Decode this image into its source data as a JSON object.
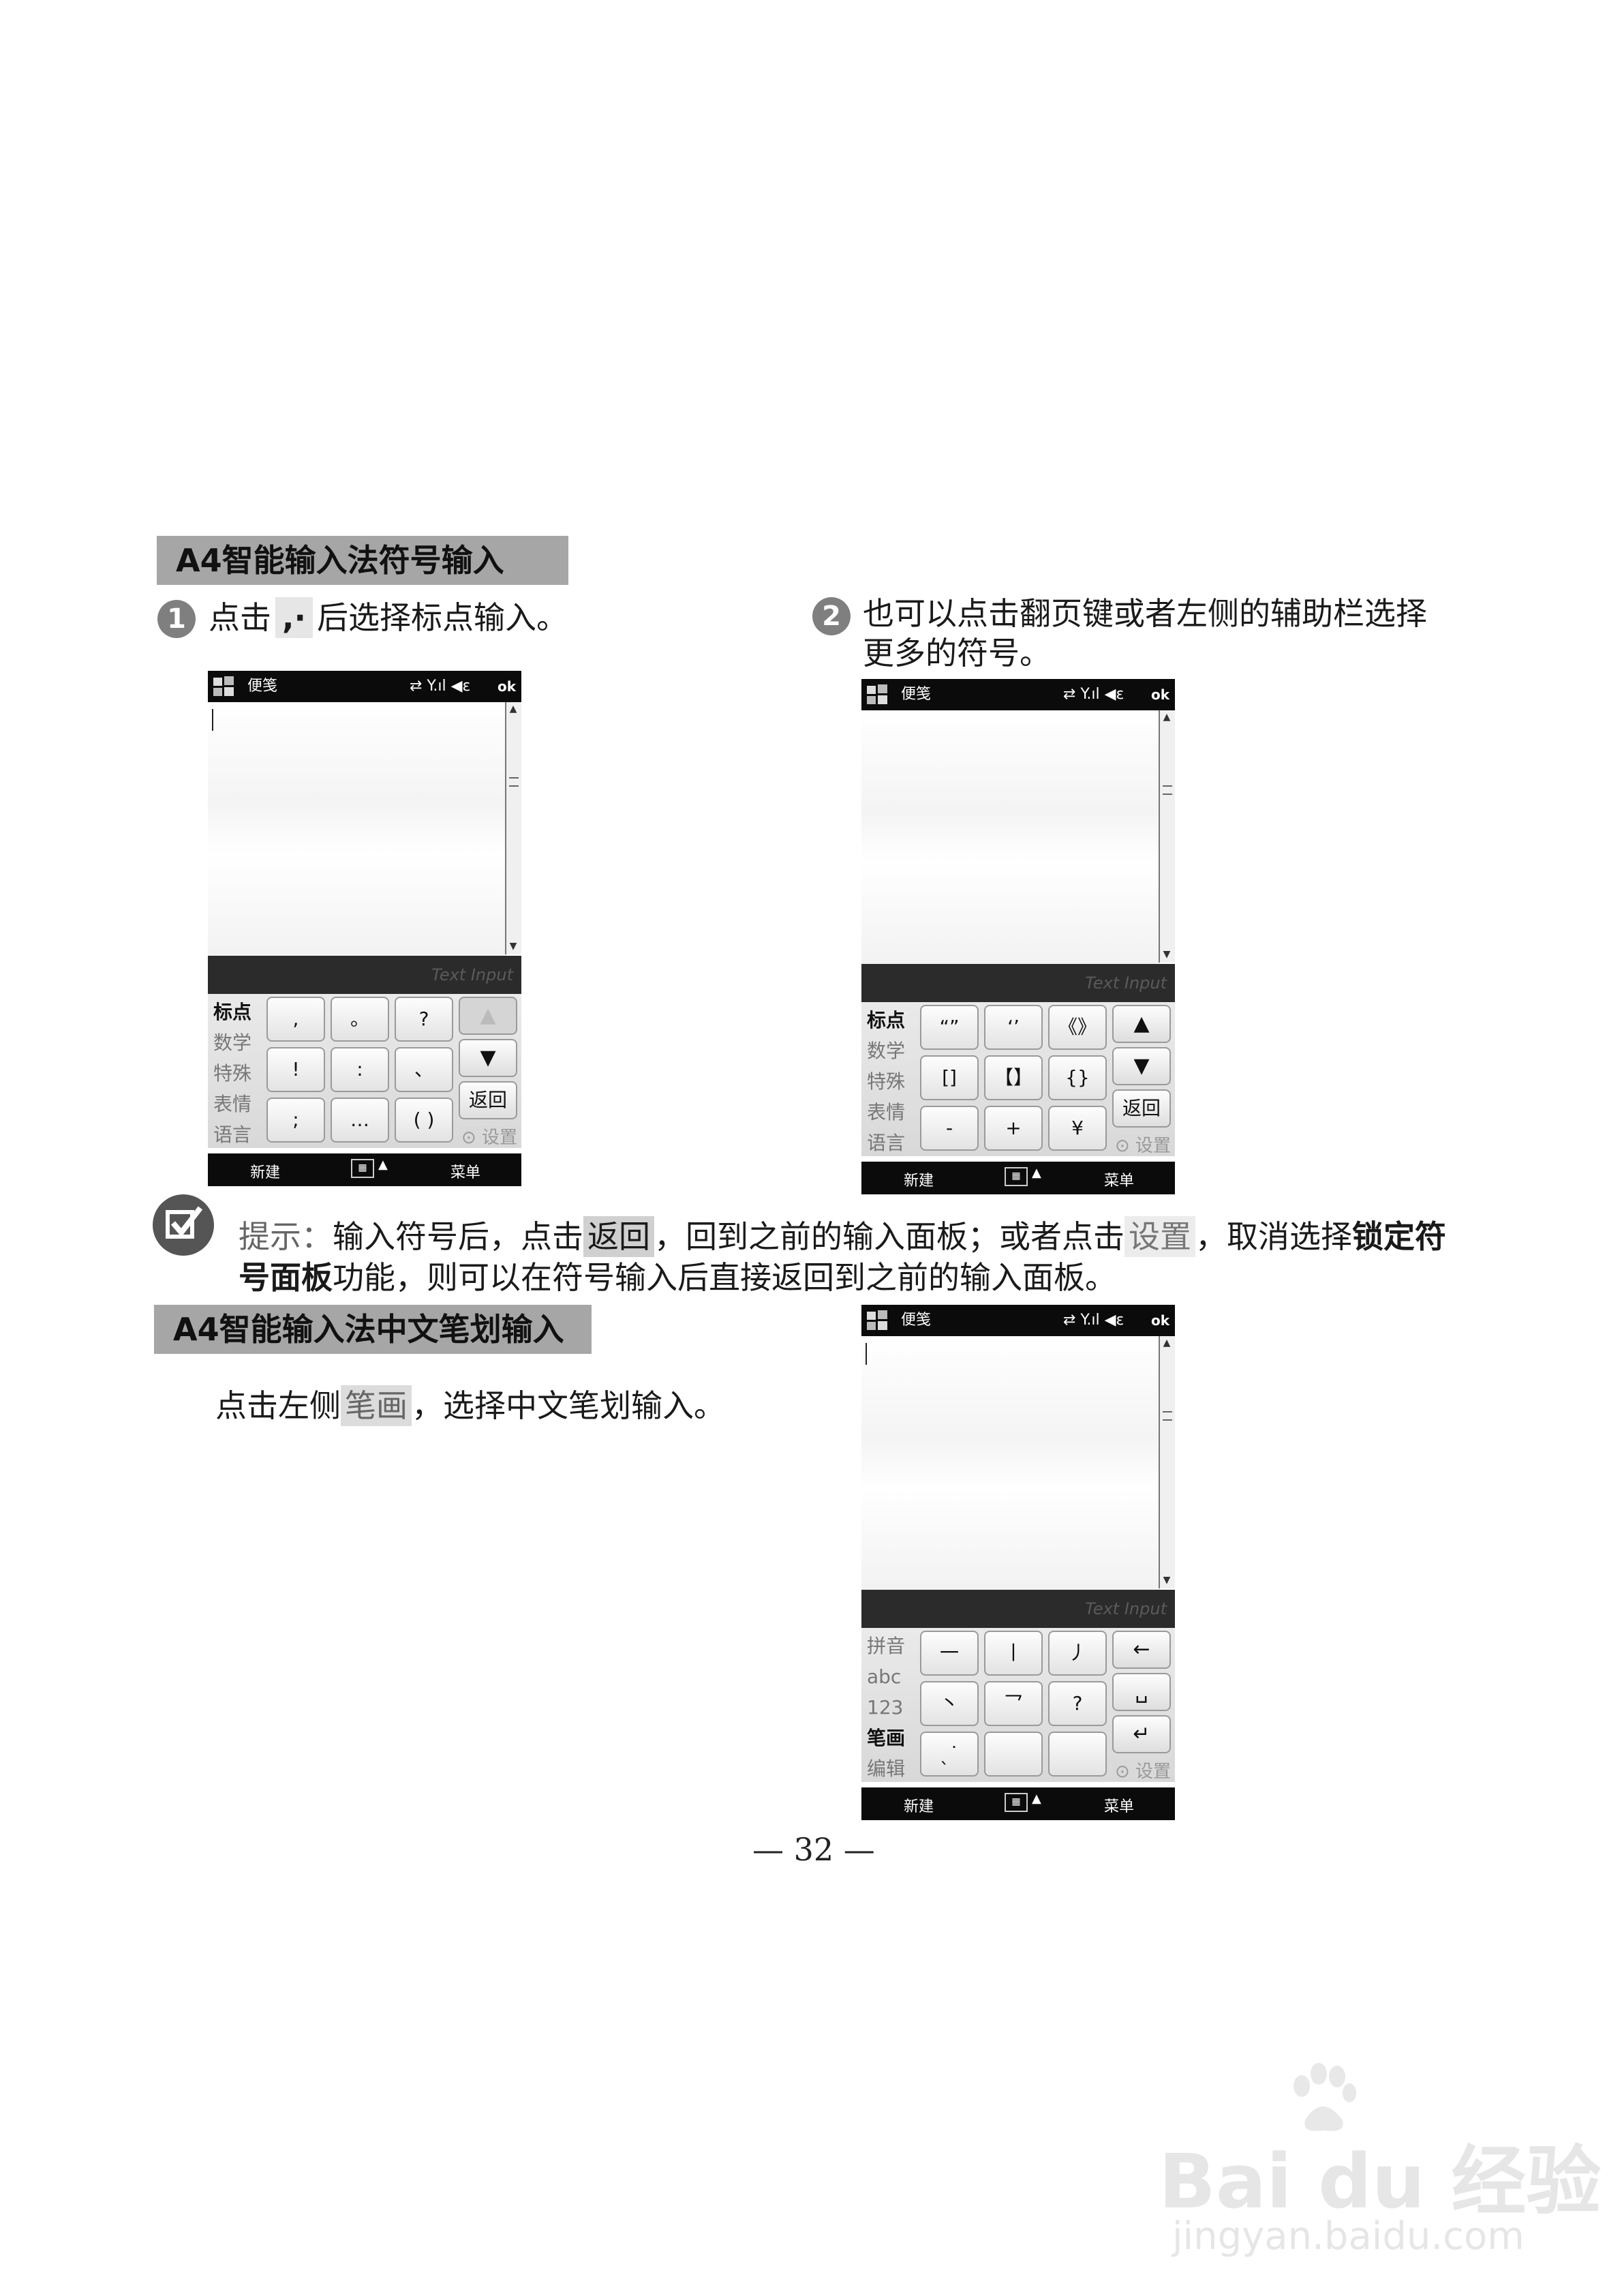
{
  "section1": {
    "title": "A4智能输入法符号输入"
  },
  "step1": {
    "num": "1",
    "before": "点击",
    "key": ",·",
    "after": "后选择标点输入。"
  },
  "step2": {
    "num": "2",
    "line1": "也可以点击翻页键或者左侧的辅助栏选择",
    "line2": "更多的符号。"
  },
  "phone_common": {
    "app_title": "便笺",
    "status_icons": "⇄ Y.ıl ◀ε",
    "ok": "ok",
    "text_input_label": "Text Input",
    "left_soft": "新建",
    "right_soft": "菜单",
    "setting": "⊙ 设置",
    "back": "返回"
  },
  "phone1": {
    "side": [
      "标点",
      "数学",
      "特殊",
      "表情",
      "语言"
    ],
    "keys": [
      ",",
      "。",
      "?",
      "!",
      ":",
      "、",
      ";",
      "…",
      "( )"
    ],
    "up": "▲",
    "down": "▼"
  },
  "phone2": {
    "side": [
      "标点",
      "数学",
      "特殊",
      "表情",
      "语言"
    ],
    "keys": [
      "“”",
      "‘’",
      "《》",
      "[]",
      "【】",
      "{}",
      "-",
      "+",
      "¥"
    ],
    "up": "▲",
    "down": "▼"
  },
  "phone3": {
    "side": [
      "拼音",
      "abc",
      "123",
      "笔画",
      "编辑"
    ],
    "keys": [
      "一",
      "丨",
      "丿",
      "丶",
      "乛",
      "?",
      "ˎ˙",
      "",
      ""
    ],
    "r1": "←",
    "r2": "␣",
    "r3": "↵"
  },
  "tip": {
    "label": "提示：",
    "t1": "输入符号后，点击",
    "back": "返回",
    "t2": "，回到之前的输入面板；或者点击",
    "setting": "设置",
    "t3": "，取消选择",
    "bold1": "锁定符",
    "bold2": "号面板",
    "t4": "功能，则可以在符号输入后直接返回到之前的输入面板。"
  },
  "section2": {
    "title": "A4智能输入法中文笔划输入"
  },
  "step3": {
    "before": "点击左侧",
    "key": "笔画",
    "after": "，选择中文笔划输入。"
  },
  "page_number": "— 32 —",
  "watermark": {
    "brand": "Bai du 经验",
    "url": "jingyan.baidu.com"
  }
}
